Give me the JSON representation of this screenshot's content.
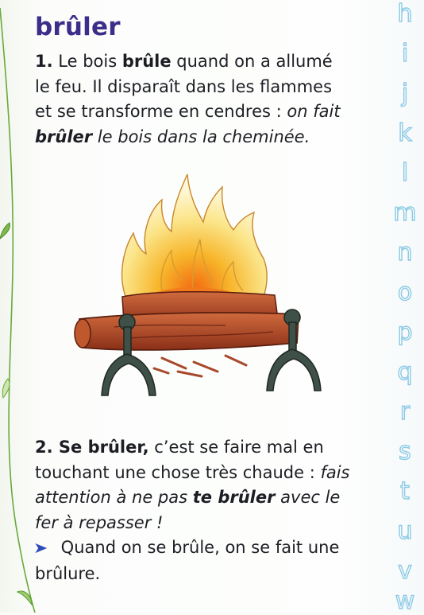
{
  "entry": {
    "title": "brûler"
  },
  "definition1": {
    "number": "1.",
    "text_a": " Le bois ",
    "bold_word": "brûle",
    "text_b": " quand on a allumé le feu. Il disparaît dans les flammes et se transforme en cendres : ",
    "example_a": "on fait ",
    "example_bold": "brûler",
    "example_b": " le bois dans la cheminée."
  },
  "definition2": {
    "number": "2.",
    "head_bold": " Se brûler,",
    "text": " c’est se faire mal en touchant une chose très chaude : ",
    "example_a": "fais attention à ne pas ",
    "example_bold": "te brûler",
    "example_b": " avec le fer à repasser !",
    "note_arrow": "➤",
    "note_text": " Quand on se brûle, on se fait une brûlure."
  },
  "alphabet": [
    "h",
    "i",
    "j",
    "k",
    "l",
    "m",
    "n",
    "o",
    "p",
    "q",
    "r",
    "s",
    "t",
    "u",
    "v",
    "w"
  ],
  "colors": {
    "title": "#3c2d8a",
    "alphabet_outline": "#86c8e4",
    "arrow": "#2e4db8",
    "vine": "#5aa33a"
  }
}
